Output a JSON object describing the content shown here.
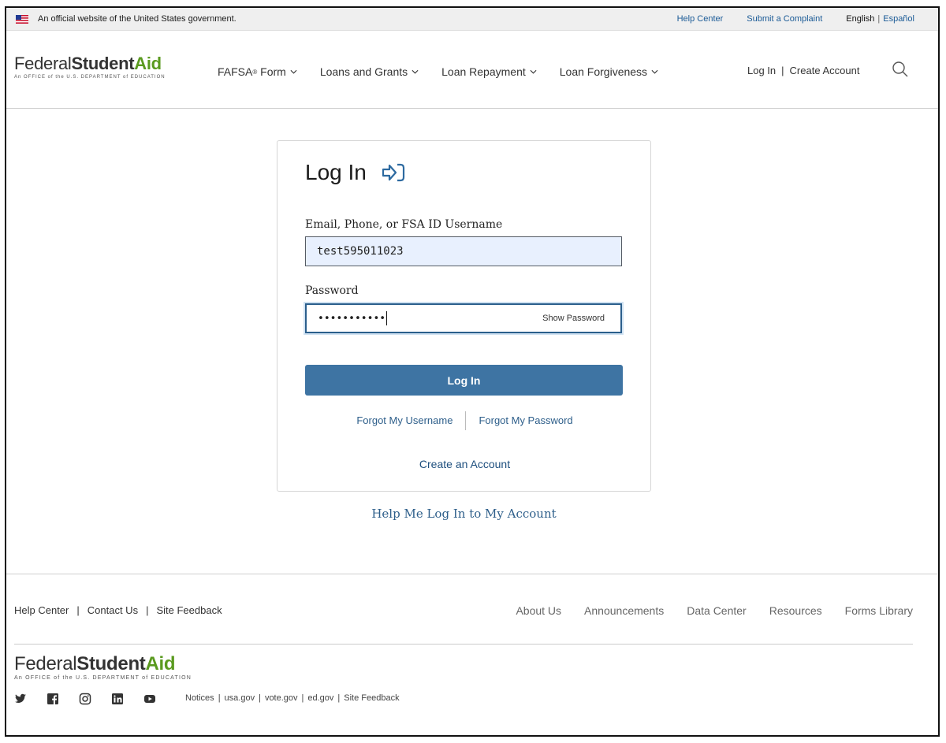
{
  "gov_banner": {
    "text": "An official website of the United States government.",
    "help_center": "Help Center",
    "submit_complaint": "Submit a Complaint",
    "lang_english": "English",
    "lang_separator": "|",
    "lang_espanol": "Español"
  },
  "logo": {
    "federal": "Federal",
    "student": "Student",
    "aid": "Aid",
    "tagline": "An OFFICE of the U.S. DEPARTMENT of EDUCATION"
  },
  "nav": {
    "fafsa": "FAFSA",
    "fafsa_mark": "®",
    "fafsa_suffix": " Form",
    "loans_grants": "Loans and Grants",
    "loan_repayment": "Loan Repayment",
    "loan_forgiveness": "Loan Forgiveness"
  },
  "auth": {
    "log_in": "Log In",
    "separator": "|",
    "create_account": "Create Account"
  },
  "login_card": {
    "title": "Log In",
    "username_label": "Email, Phone, or FSA ID Username",
    "username_value": "test595011023",
    "password_label": "Password",
    "password_value": "•••••••••••",
    "show_password": "Show Password",
    "login_button": "Log In",
    "forgot_username": "Forgot My Username",
    "forgot_password": "Forgot My Password",
    "create_account": "Create an Account"
  },
  "help_link": "Help Me Log In to My Account",
  "footer": {
    "help_center": "Help Center",
    "contact_us": "Contact Us",
    "site_feedback": "Site Feedback",
    "separator": "|",
    "about_us": "About Us",
    "announcements": "Announcements",
    "data_center": "Data Center",
    "resources": "Resources",
    "forms_library": "Forms Library",
    "bottom_links": {
      "notices": "Notices",
      "usagov": "usa.gov",
      "votegov": "vote.gov",
      "edgov": "ed.gov",
      "site_feedback": "Site Feedback"
    },
    "social_icons": [
      "twitter-icon",
      "facebook-icon",
      "instagram-icon",
      "linkedin-icon",
      "youtube-icon"
    ]
  },
  "colors": {
    "brand_green": "#5a9a1f",
    "primary_blue": "#3e74a3",
    "link_blue": "#2d5e8a"
  }
}
